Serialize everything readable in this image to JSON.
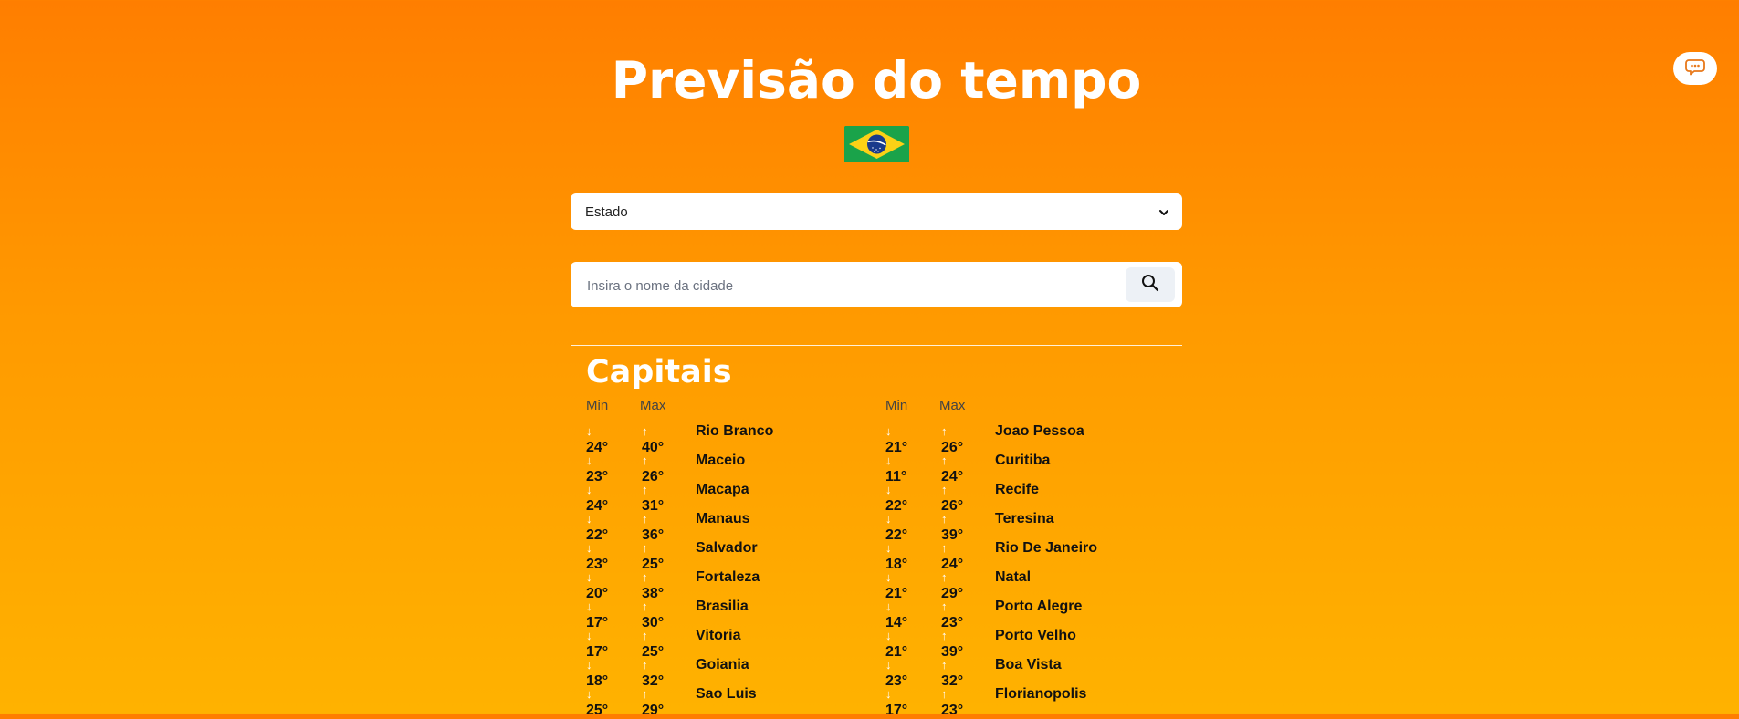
{
  "header": {
    "title": "Previsão do tempo",
    "flag_icon": "brazil-flag-icon"
  },
  "state_select": {
    "selected": "Estado",
    "icon": "chevron-down-icon"
  },
  "search": {
    "placeholder": "Insira o nome da cidade",
    "value": "",
    "icon": "search-icon"
  },
  "capitals": {
    "title": "Capitais",
    "min_label": "Min",
    "max_label": "Max",
    "left": [
      {
        "min": "24°",
        "max": "40°",
        "city": "Rio Branco"
      },
      {
        "min": "23°",
        "max": "26°",
        "city": "Maceio"
      },
      {
        "min": "24°",
        "max": "31°",
        "city": "Macapa"
      },
      {
        "min": "22°",
        "max": "36°",
        "city": "Manaus"
      },
      {
        "min": "23°",
        "max": "25°",
        "city": "Salvador"
      },
      {
        "min": "20°",
        "max": "38°",
        "city": "Fortaleza"
      },
      {
        "min": "17°",
        "max": "30°",
        "city": "Brasilia"
      },
      {
        "min": "17°",
        "max": "25°",
        "city": "Vitoria"
      },
      {
        "min": "18°",
        "max": "32°",
        "city": "Goiania"
      },
      {
        "min": "25°",
        "max": "29°",
        "city": "Sao Luis"
      }
    ],
    "right": [
      {
        "min": "21°",
        "max": "26°",
        "city": "Joao Pessoa"
      },
      {
        "min": "11°",
        "max": "24°",
        "city": "Curitiba"
      },
      {
        "min": "22°",
        "max": "26°",
        "city": "Recife"
      },
      {
        "min": "22°",
        "max": "39°",
        "city": "Teresina"
      },
      {
        "min": "18°",
        "max": "24°",
        "city": "Rio De Janeiro"
      },
      {
        "min": "21°",
        "max": "29°",
        "city": "Natal"
      },
      {
        "min": "14°",
        "max": "23°",
        "city": "Porto Alegre"
      },
      {
        "min": "21°",
        "max": "39°",
        "city": "Porto Velho"
      },
      {
        "min": "23°",
        "max": "32°",
        "city": "Boa Vista"
      },
      {
        "min": "17°",
        "max": "23°",
        "city": "Florianopolis"
      }
    ]
  },
  "chat": {
    "icon": "chat-bot-icon"
  },
  "colors": {
    "bg_top": "#ff7e00",
    "bg_bottom": "#ffb200",
    "text_dark": "#111111",
    "white": "#ffffff"
  }
}
